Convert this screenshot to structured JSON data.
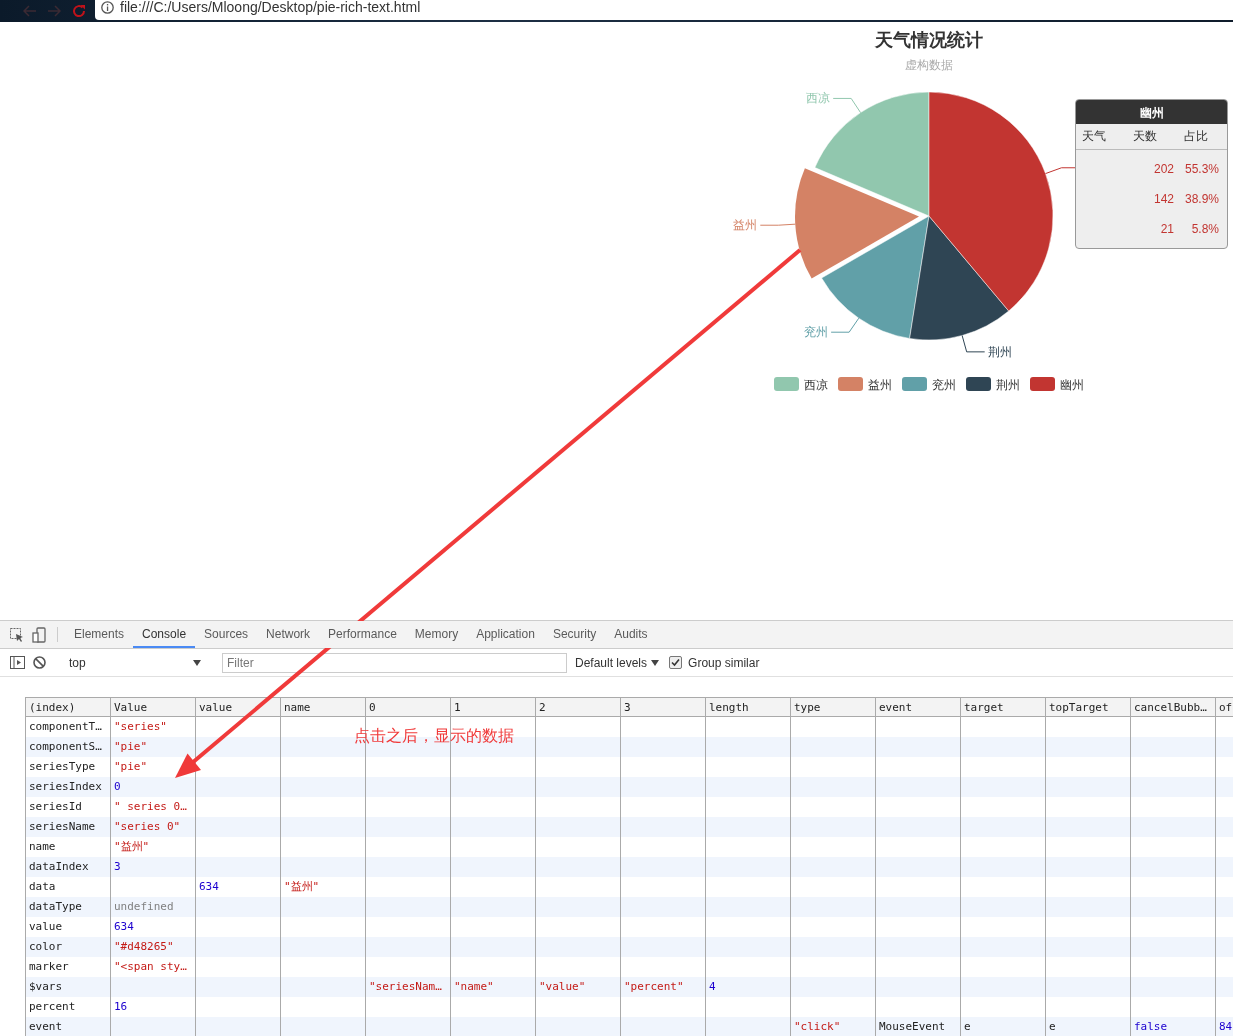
{
  "browser": {
    "url": "file:///C:/Users/Mloong/Desktop/pie-rich-text.html"
  },
  "chart": {
    "title": "天气情况统计",
    "subtitle": "虚构数据",
    "slices": [
      {
        "label": "西凉",
        "color": "#91c7ae",
        "selected": false
      },
      {
        "label": "益州",
        "color": "#d48265",
        "selected": true
      },
      {
        "label": "兖州",
        "color": "#61a0a8",
        "selected": false
      },
      {
        "label": "荆州",
        "color": "#2f4554",
        "selected": false
      },
      {
        "color": "#c23531",
        "selected": false
      }
    ],
    "legend": [
      {
        "name": "西凉",
        "color": "#91c7ae"
      },
      {
        "name": "益州",
        "color": "#d48265"
      },
      {
        "name": "兖州",
        "color": "#61a0a8"
      },
      {
        "name": "荆州",
        "color": "#2f4554"
      },
      {
        "name": "幽州",
        "color": "#c23531"
      }
    ],
    "tooltip": {
      "title": "幽州",
      "headers": [
        "天气",
        "天数",
        "占比"
      ],
      "rows": [
        [
          "202",
          "55.3%"
        ],
        [
          "142",
          "38.9%"
        ],
        [
          "21",
          "5.8%"
        ]
      ]
    }
  },
  "devtools": {
    "tabs": [
      {
        "label": "Elements",
        "selected": false
      },
      {
        "label": "Console",
        "selected": true
      },
      {
        "label": "Sources",
        "selected": false
      },
      {
        "label": "Network",
        "selected": false
      },
      {
        "label": "Performance",
        "selected": false
      },
      {
        "label": "Memory",
        "selected": false
      },
      {
        "label": "Application",
        "selected": false
      },
      {
        "label": "Security",
        "selected": false
      },
      {
        "label": "Audits",
        "selected": false
      }
    ],
    "context": "top",
    "filter_placeholder": "Filter",
    "levels": "Default levels",
    "group_similar": {
      "label": "Group similar",
      "checked": true
    }
  },
  "console_table": {
    "columns": [
      "(index)",
      "Value",
      "value",
      "name",
      "0",
      "1",
      "2",
      "3",
      "length",
      "type",
      "event",
      "target",
      "topTarget",
      "cancelBubb…",
      "of"
    ],
    "rows": [
      {
        "cells": [
          {
            "text": "componentT…",
            "kind": "plain"
          },
          {
            "text": "\"series\"",
            "kind": "string"
          },
          null,
          null,
          null,
          null,
          null,
          null,
          null,
          null,
          null,
          null,
          null,
          null,
          null
        ]
      },
      {
        "cells": [
          {
            "text": "componentS…",
            "kind": "plain"
          },
          {
            "text": "\"pie\"",
            "kind": "string"
          },
          null,
          null,
          null,
          null,
          null,
          null,
          null,
          null,
          null,
          null,
          null,
          null,
          null
        ]
      },
      {
        "cells": [
          {
            "text": "seriesType",
            "kind": "plain"
          },
          {
            "text": "\"pie\"",
            "kind": "string"
          },
          null,
          null,
          null,
          null,
          null,
          null,
          null,
          null,
          null,
          null,
          null,
          null,
          null
        ]
      },
      {
        "cells": [
          {
            "text": "seriesIndex",
            "kind": "plain"
          },
          {
            "text": "0",
            "kind": "number"
          },
          null,
          null,
          null,
          null,
          null,
          null,
          null,
          null,
          null,
          null,
          null,
          null,
          null
        ]
      },
      {
        "cells": [
          {
            "text": "seriesId",
            "kind": "plain"
          },
          {
            "text": "\" series 0…",
            "kind": "string"
          },
          null,
          null,
          null,
          null,
          null,
          null,
          null,
          null,
          null,
          null,
          null,
          null,
          null
        ]
      },
      {
        "cells": [
          {
            "text": "seriesName",
            "kind": "plain"
          },
          {
            "text": "\"series 0\"",
            "kind": "string"
          },
          null,
          null,
          null,
          null,
          null,
          null,
          null,
          null,
          null,
          null,
          null,
          null,
          null
        ]
      },
      {
        "cells": [
          {
            "text": "name",
            "kind": "plain"
          },
          {
            "text": "\"益州\"",
            "kind": "string"
          },
          null,
          null,
          null,
          null,
          null,
          null,
          null,
          null,
          null,
          null,
          null,
          null,
          null
        ]
      },
      {
        "cells": [
          {
            "text": "dataIndex",
            "kind": "plain"
          },
          {
            "text": "3",
            "kind": "number"
          },
          null,
          null,
          null,
          null,
          null,
          null,
          null,
          null,
          null,
          null,
          null,
          null,
          null
        ]
      },
      {
        "cells": [
          {
            "text": "data",
            "kind": "plain"
          },
          null,
          {
            "text": "634",
            "kind": "number"
          },
          {
            "text": "\"益州\"",
            "kind": "string"
          },
          null,
          null,
          null,
          null,
          null,
          null,
          null,
          null,
          null,
          null,
          null
        ]
      },
      {
        "cells": [
          {
            "text": "dataType",
            "kind": "plain"
          },
          {
            "text": "undefined",
            "kind": "undefined"
          },
          null,
          null,
          null,
          null,
          null,
          null,
          null,
          null,
          null,
          null,
          null,
          null,
          null
        ]
      },
      {
        "cells": [
          {
            "text": "value",
            "kind": "plain"
          },
          {
            "text": "634",
            "kind": "number"
          },
          null,
          null,
          null,
          null,
          null,
          null,
          null,
          null,
          null,
          null,
          null,
          null,
          null
        ]
      },
      {
        "cells": [
          {
            "text": "color",
            "kind": "plain"
          },
          {
            "text": "\"#d48265\"",
            "kind": "string"
          },
          null,
          null,
          null,
          null,
          null,
          null,
          null,
          null,
          null,
          null,
          null,
          null,
          null
        ]
      },
      {
        "cells": [
          {
            "text": "marker",
            "kind": "plain"
          },
          {
            "text": "\"<span sty…",
            "kind": "string"
          },
          null,
          null,
          null,
          null,
          null,
          null,
          null,
          null,
          null,
          null,
          null,
          null,
          null
        ]
      },
      {
        "cells": [
          {
            "text": "$vars",
            "kind": "plain"
          },
          null,
          null,
          null,
          {
            "text": "\"seriesNam…",
            "kind": "string"
          },
          {
            "text": "\"name\"",
            "kind": "string"
          },
          {
            "text": "\"value\"",
            "kind": "string"
          },
          {
            "text": "\"percent\"",
            "kind": "string"
          },
          {
            "text": "4",
            "kind": "number"
          },
          null,
          null,
          null,
          null,
          null,
          null
        ]
      },
      {
        "cells": [
          {
            "text": "percent",
            "kind": "plain"
          },
          {
            "text": "16",
            "kind": "number"
          },
          null,
          null,
          null,
          null,
          null,
          null,
          null,
          null,
          null,
          null,
          null,
          null,
          null
        ]
      },
      {
        "cells": [
          {
            "text": "event",
            "kind": "plain"
          },
          null,
          null,
          null,
          null,
          null,
          null,
          null,
          null,
          {
            "text": "\"click\"",
            "kind": "string"
          },
          {
            "text": "MouseEvent",
            "kind": "plain"
          },
          {
            "text": "e",
            "kind": "plain"
          },
          {
            "text": "e",
            "kind": "plain"
          },
          {
            "text": "false",
            "kind": "number"
          },
          {
            "text": "84",
            "kind": "number"
          }
        ]
      }
    ]
  },
  "annotation": {
    "text": "点击之后，显示的数据"
  }
}
